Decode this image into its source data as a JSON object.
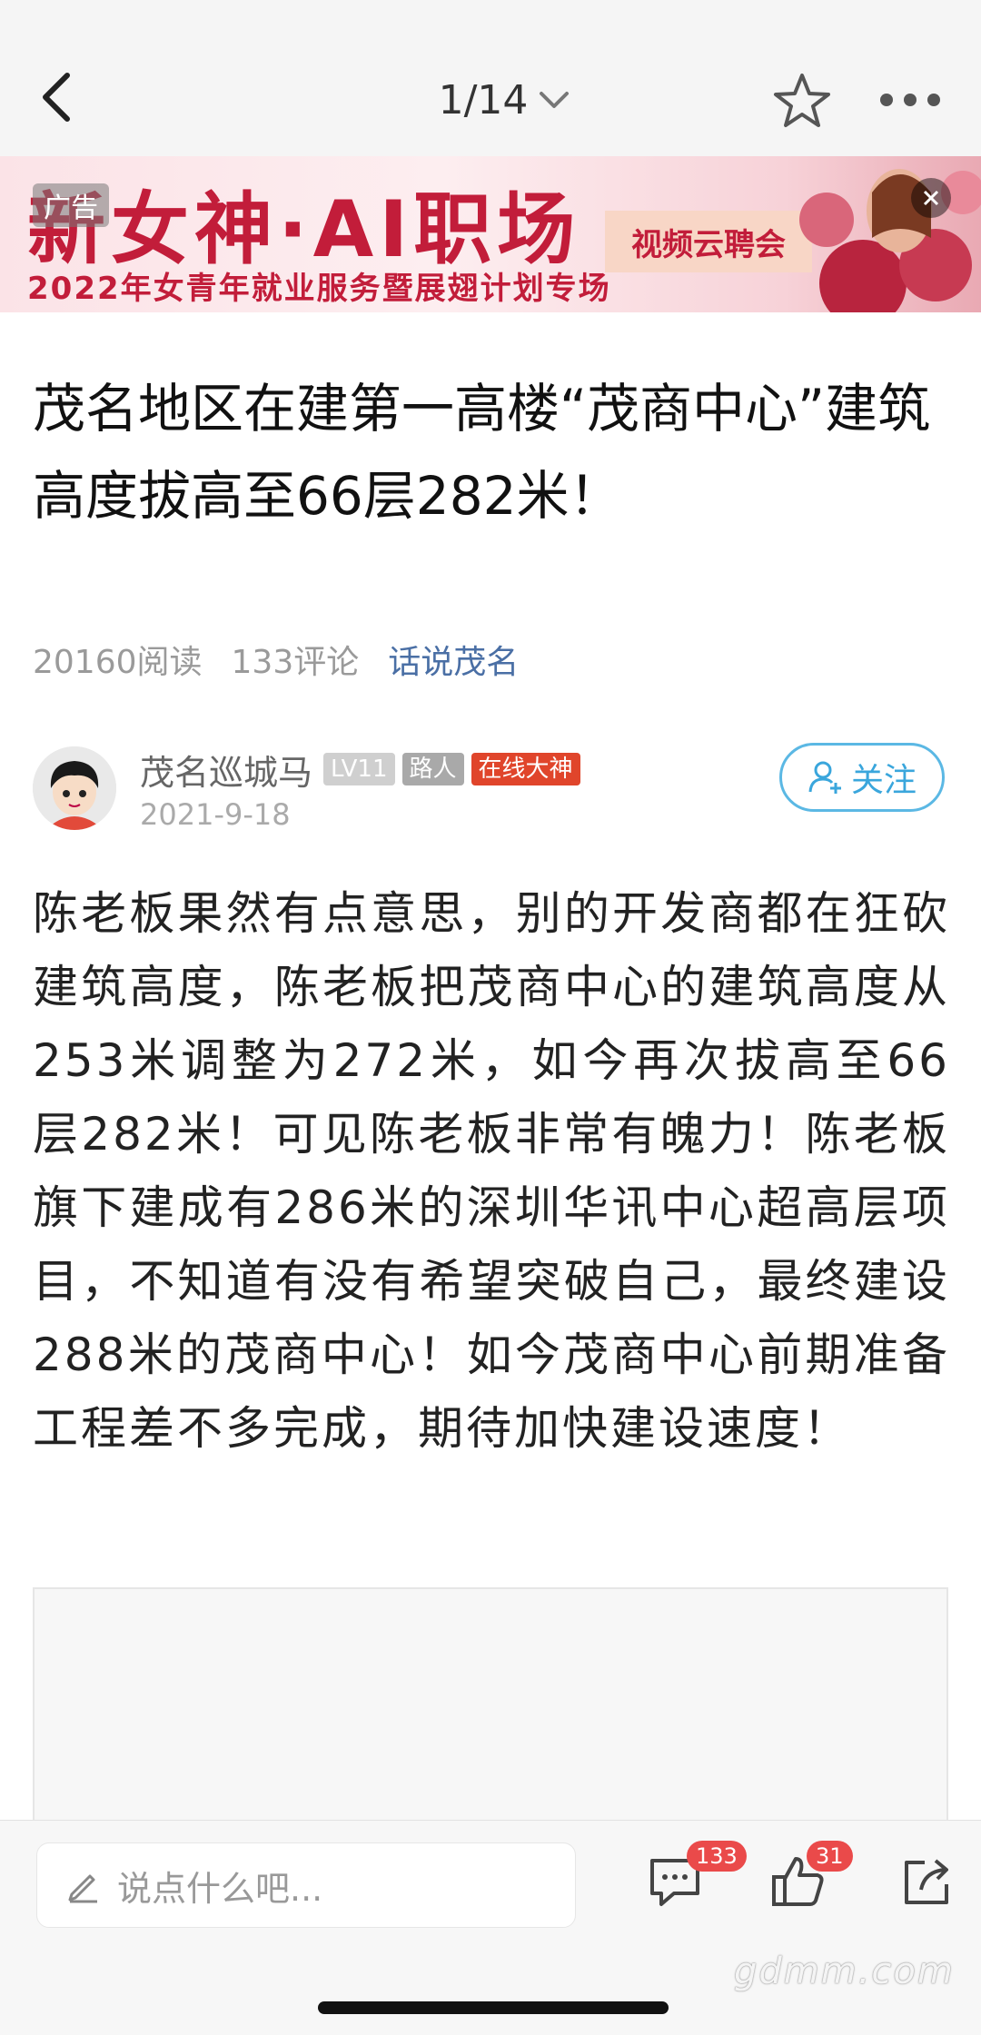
{
  "nav": {
    "page_indicator": "1/14"
  },
  "ad": {
    "tag": "广告",
    "title": "新女神·AI职场",
    "subtitle": "2022年女青年就业服务暨展翅计划专场",
    "cta": "视频云聘会"
  },
  "article": {
    "title": "茂名地区在建第一高楼“茂商中心”建筑高度拔高至66层282米！",
    "reads": "20160阅读",
    "comments": "133评论",
    "topic": "话说茂名",
    "author": {
      "name": "茂名巡城马",
      "level": "LV11",
      "role": "路人",
      "honor": "在线大神",
      "date": "2021-9-18"
    },
    "follow_label": "关注",
    "body": "陈老板果然有点意思，别的开发商都在狂砍建筑高度，陈老板把茂商中心的建筑高度从253米调整为272米，如今再次拔高至66层282米！可见陈老板非常有魄力！陈老板旗下建成有286米的深圳华讯中心超高层项目，不知道有没有希望突破自己，最终建设288米的茂商中心！如今茂商中心前期准备工程差不多完成，期待加快建设速度！"
  },
  "bottom": {
    "comment_placeholder": "说点什么吧...",
    "comment_count": "133",
    "like_count": "31"
  },
  "watermark": "gdmm.com",
  "colors": {
    "accent_blue": "#3aa6dc",
    "topic_blue": "#4a6fa5",
    "badge_red": "#e0452b",
    "ad_red": "#c21d3a"
  }
}
